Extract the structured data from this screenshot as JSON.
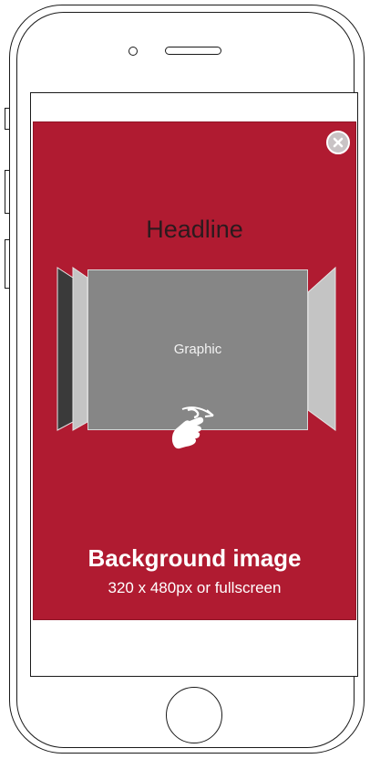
{
  "ad": {
    "headline": "Headline",
    "graphic_label": "Graphic",
    "background_title": "Background image",
    "background_subtitle": "320 x 480px or fullscreen",
    "close_icon": "close-icon",
    "gesture_icon": "swipe-hand-icon"
  },
  "colors": {
    "ad_background": "#b01b31",
    "graphic_fill": "#868686",
    "side_card_fill": "#c4c4c4",
    "back_card_fill": "#3a3a3a",
    "close_button_fill": "#c9c3c5",
    "text_light": "#ffffff",
    "headline_text": "#2b1a1e"
  }
}
